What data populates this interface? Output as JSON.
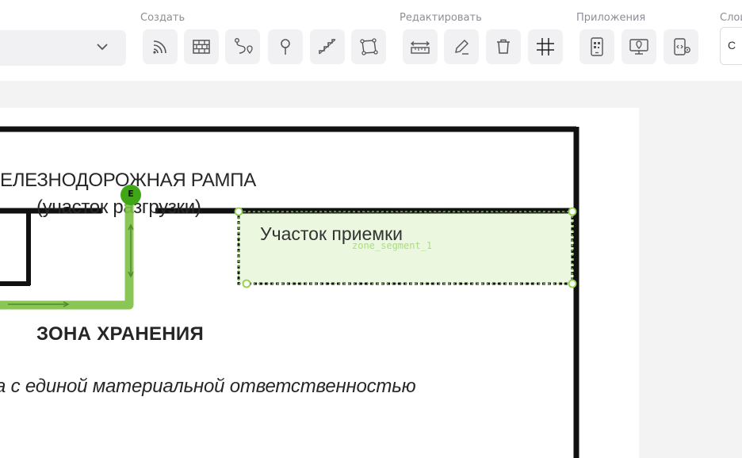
{
  "toolbar": {
    "groups": {
      "create": "Создать",
      "edit": "Редактировать",
      "apps": "Приложения",
      "layers": "Слои"
    },
    "select_chevron_icon": "chevron-down-icon",
    "layer_select_value": "С",
    "create_tools": [
      "signal-icon",
      "wall-icon",
      "route-icon",
      "pin-icon",
      "stairs-icon",
      "polygon-icon"
    ],
    "edit_tools": [
      "ruler-icon",
      "pencil-icon",
      "trash-icon",
      "grid-icon"
    ],
    "app_tools": [
      "qr-code-icon",
      "monitor-location-icon",
      "code-settings-icon"
    ]
  },
  "plan": {
    "ramp_title": "ЕЛЕЗНОДОРОЖНАЯ РАМПА",
    "ramp_subtitle": "(участок разгрузки)",
    "storage_zone": "ЗОНА ХРАНЕНИЯ",
    "responsibility_text": "а с единой материальной ответственностью",
    "route_marker_label": "E"
  },
  "zone": {
    "title": "Участок приемки",
    "segment_id": "zone_segment_1",
    "color": "#8fd14f"
  },
  "colors": {
    "route_green": "#7cc043",
    "marker_green": "#3fa616",
    "wall_black": "#111111"
  }
}
